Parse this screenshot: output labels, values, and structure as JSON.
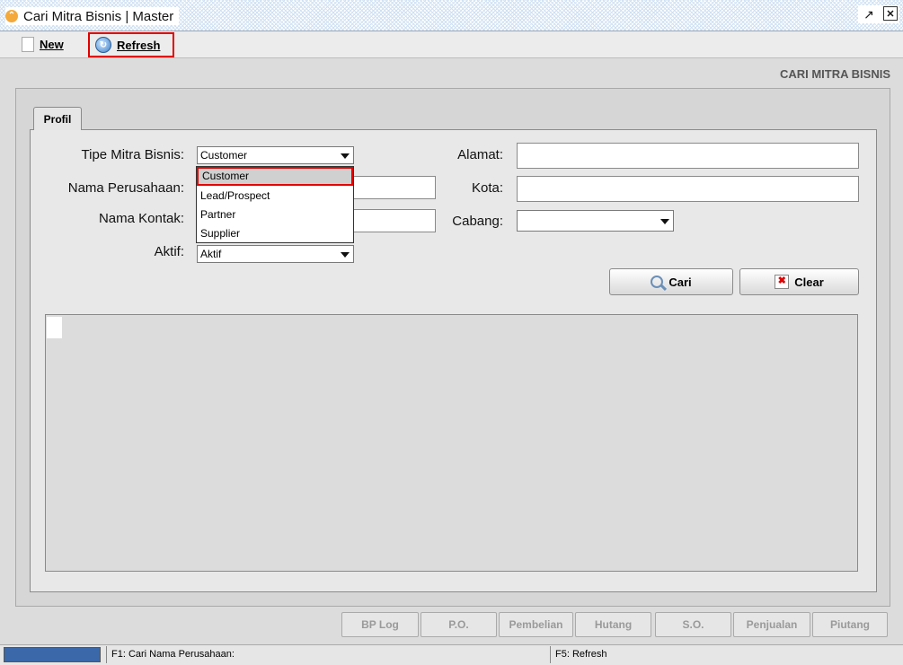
{
  "window": {
    "title": "Cari Mitra Bisnis | Master"
  },
  "toolbar": {
    "new_label": "New",
    "refresh_label": "Refresh"
  },
  "page_title": "CARI MITRA BISNIS",
  "tab": {
    "label": "Profil"
  },
  "form": {
    "tipe_label": "Tipe Mitra Bisnis:",
    "tipe_value": "Customer",
    "tipe_options": [
      "Customer",
      "Lead/Prospect",
      "Partner",
      "Supplier"
    ],
    "nama_perusahaan_label": "Nama Perusahaan:",
    "nama_perusahaan_value": "",
    "nama_kontak_label": "Nama Kontak:",
    "nama_kontak_value": "",
    "aktif_label": "Aktif:",
    "aktif_value": "Aktif",
    "alamat_label": "Alamat:",
    "alamat_value": "",
    "kota_label": "Kota:",
    "kota_value": "",
    "cabang_label": "Cabang:",
    "cabang_value": ""
  },
  "actions": {
    "cari_label": "Cari",
    "clear_label": "Clear"
  },
  "bottom_buttons": [
    "BP Log",
    "P.O.",
    "Pembelian",
    "Hutang",
    "S.O.",
    "Penjualan",
    "Piutang"
  ],
  "status": {
    "left": "F1: Cari Nama Perusahaan:",
    "right": "F5: Refresh"
  }
}
